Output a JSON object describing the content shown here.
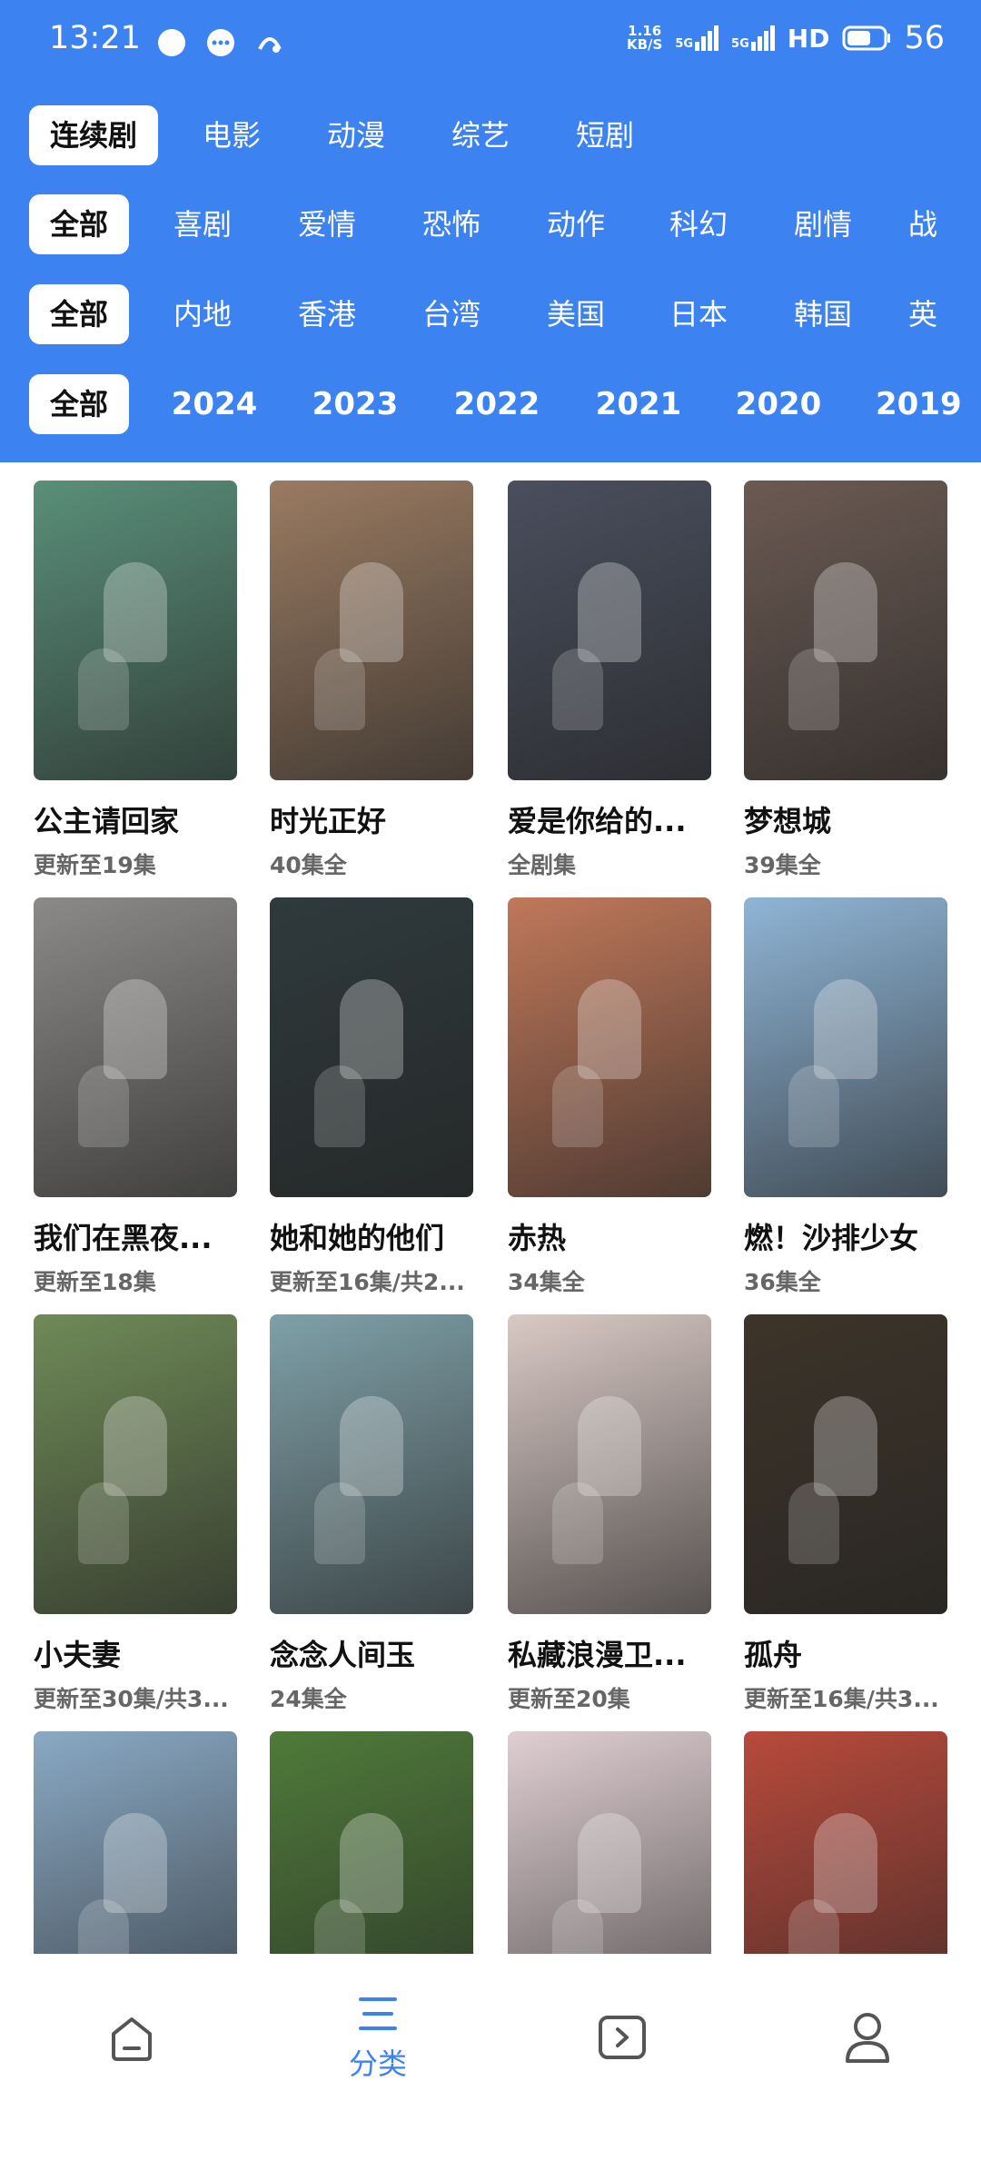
{
  "status_bar": {
    "time": "13:21",
    "network_speed_value": "1.16",
    "network_speed_unit": "KB/S",
    "signal1": "5G",
    "signal2": "5G",
    "hd": "HD",
    "battery": "56"
  },
  "tabs": [
    "连续剧",
    "电影",
    "动漫",
    "综艺",
    "短剧"
  ],
  "genres": [
    "全部",
    "喜剧",
    "爱情",
    "恐怖",
    "动作",
    "科幻",
    "剧情",
    "战"
  ],
  "regions": [
    "全部",
    "内地",
    "香港",
    "台湾",
    "美国",
    "日本",
    "韩国",
    "英"
  ],
  "years": [
    "全部",
    "2024",
    "2023",
    "2022",
    "2021",
    "2020",
    "2019"
  ],
  "items": [
    {
      "title": "公主请回家",
      "sub": "更新至19集",
      "color": "#5a8f7a"
    },
    {
      "title": "时光正好",
      "sub": "40集全",
      "color": "#9a7b62"
    },
    {
      "title": "爱是你给的...",
      "sub": "全剧集",
      "color": "#4a4f5e"
    },
    {
      "title": "梦想城",
      "sub": "39集全",
      "color": "#6b5a52"
    },
    {
      "title": "我们在黑夜...",
      "sub": "更新至18集",
      "color": "#8c8a88"
    },
    {
      "title": "她和她的他们",
      "sub": "更新至16集/共2...",
      "color": "#2f3a3c"
    },
    {
      "title": "赤热",
      "sub": "34集全",
      "color": "#c0785a"
    },
    {
      "title": "燃！沙排少女",
      "sub": "36集全",
      "color": "#8fb5d6"
    },
    {
      "title": "小夫妻",
      "sub": "更新至30集/共3...",
      "color": "#6f8a57"
    },
    {
      "title": "念念人间玉",
      "sub": "24集全",
      "color": "#7fa0a8"
    },
    {
      "title": "私藏浪漫卫...",
      "sub": "更新至20集",
      "color": "#d9c9c4"
    },
    {
      "title": "孤舟",
      "sub": "更新至16集/共3...",
      "color": "#3d3429"
    },
    {
      "title": "",
      "sub": "",
      "color": "#8aa9c4"
    },
    {
      "title": "",
      "sub": "",
      "color": "#4f7a3a"
    },
    {
      "title": "",
      "sub": "",
      "color": "#e0cfd2"
    },
    {
      "title": "",
      "sub": "",
      "color": "#b84a3c"
    }
  ],
  "bottom_nav": {
    "category_label": "分类"
  },
  "colors": {
    "accent": "#3c82f0",
    "nav_icon_inactive": "#555555"
  }
}
